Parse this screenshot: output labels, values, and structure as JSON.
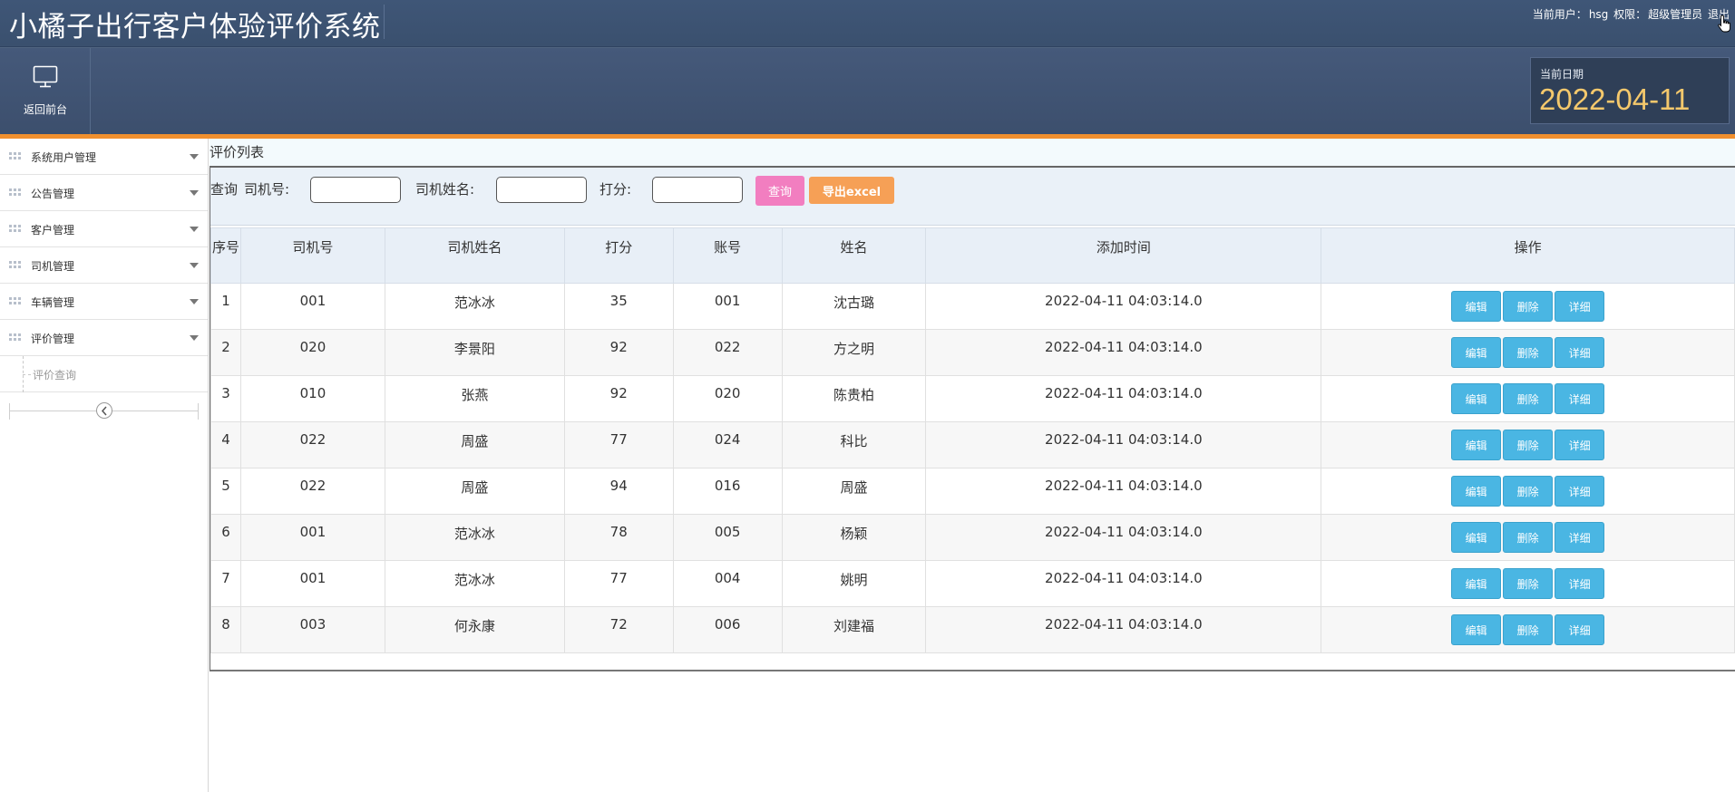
{
  "header": {
    "app_title": "小橘子出行客户体验评价系统",
    "current_user_label": "当前用户：",
    "current_user": "hsg",
    "role_label": "权限：",
    "role": "超级管理员",
    "logout_label": "退出"
  },
  "subbar": {
    "home_label": "返回前台",
    "home_icon": "monitor-icon",
    "date_caption": "当前日期",
    "date_value": "2022-04-11"
  },
  "sidebar": {
    "items": [
      {
        "label": "系统用户管理"
      },
      {
        "label": "公告管理"
      },
      {
        "label": "客户管理"
      },
      {
        "label": "司机管理"
      },
      {
        "label": "车辆管理"
      },
      {
        "label": "评价管理"
      }
    ],
    "sub_items": [
      {
        "label": "评价查询"
      }
    ]
  },
  "main": {
    "panel_title": "评价列表",
    "search": {
      "prefix": "查询",
      "driver_no_label": "司机号:",
      "driver_name_label": "司机姓名:",
      "score_label": "打分:",
      "driver_no_value": "",
      "driver_name_value": "",
      "score_value": "",
      "query_button": "查询",
      "export_button": "导出excel"
    },
    "table": {
      "headers": {
        "seq": "序号",
        "driver_no": "司机号",
        "driver_name": "司机姓名",
        "score": "打分",
        "account": "账号",
        "name": "姓名",
        "added_time": "添加时间",
        "actions": "操作"
      },
      "action_labels": {
        "edit": "编辑",
        "delete": "删除",
        "detail": "详细"
      },
      "rows": [
        {
          "seq": "1",
          "driver_no": "001",
          "driver_name": "范冰冰",
          "score": "35",
          "account": "001",
          "name": "沈古璐",
          "added_time": "2022-04-11 04:03:14.0"
        },
        {
          "seq": "2",
          "driver_no": "020",
          "driver_name": "李景阳",
          "score": "92",
          "account": "022",
          "name": "方之明",
          "added_time": "2022-04-11 04:03:14.0"
        },
        {
          "seq": "3",
          "driver_no": "010",
          "driver_name": "张燕",
          "score": "92",
          "account": "020",
          "name": "陈贵柏",
          "added_time": "2022-04-11 04:03:14.0"
        },
        {
          "seq": "4",
          "driver_no": "022",
          "driver_name": "周盛",
          "score": "77",
          "account": "024",
          "name": "科比",
          "added_time": "2022-04-11 04:03:14.0"
        },
        {
          "seq": "5",
          "driver_no": "022",
          "driver_name": "周盛",
          "score": "94",
          "account": "016",
          "name": "周盛",
          "added_time": "2022-04-11 04:03:14.0"
        },
        {
          "seq": "6",
          "driver_no": "001",
          "driver_name": "范冰冰",
          "score": "78",
          "account": "005",
          "name": "杨颖",
          "added_time": "2022-04-11 04:03:14.0"
        },
        {
          "seq": "7",
          "driver_no": "001",
          "driver_name": "范冰冰",
          "score": "77",
          "account": "004",
          "name": "姚明",
          "added_time": "2022-04-11 04:03:14.0"
        },
        {
          "seq": "8",
          "driver_no": "003",
          "driver_name": "何永康",
          "score": "72",
          "account": "006",
          "name": "刘建福",
          "added_time": "2022-04-11 04:03:14.0"
        }
      ]
    }
  },
  "colors": {
    "banner": "#3f5677",
    "accent_bar": "#f08f2e",
    "date_text": "#f4c86c",
    "query_button": "#f27ec0",
    "export_button": "#f6a056",
    "action_button": "#4ab6e3"
  }
}
